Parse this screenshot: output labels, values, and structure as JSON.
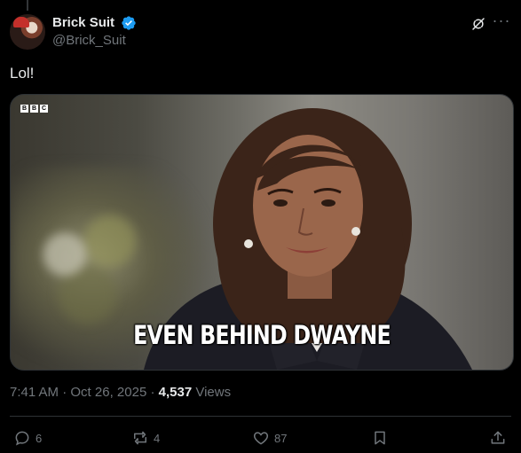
{
  "author": {
    "display_name": "Brick Suit",
    "handle": "@Brick_Suit"
  },
  "tweet": {
    "text": "Lol!"
  },
  "media": {
    "logo": [
      "B",
      "B",
      "C"
    ],
    "caption": "EVEN BEHIND DWAYNE"
  },
  "meta": {
    "time": "7:41 AM",
    "date": "Oct 26, 2025",
    "views_count": "4,537",
    "views_label": "Views",
    "separator": "·"
  },
  "actions": {
    "replies": "6",
    "reposts": "4",
    "likes": "87"
  },
  "icons": {
    "verified": "verified-badge-icon",
    "grok": "grok-icon",
    "more": "more-icon",
    "reply": "reply-icon",
    "repost": "repost-icon",
    "like": "heart-icon",
    "bookmark": "bookmark-icon",
    "share": "share-icon"
  },
  "colors": {
    "background": "#000000",
    "text": "#e7e9ea",
    "secondary": "#71767b",
    "verified": "#1d9bf0",
    "divider": "#2f3336"
  }
}
